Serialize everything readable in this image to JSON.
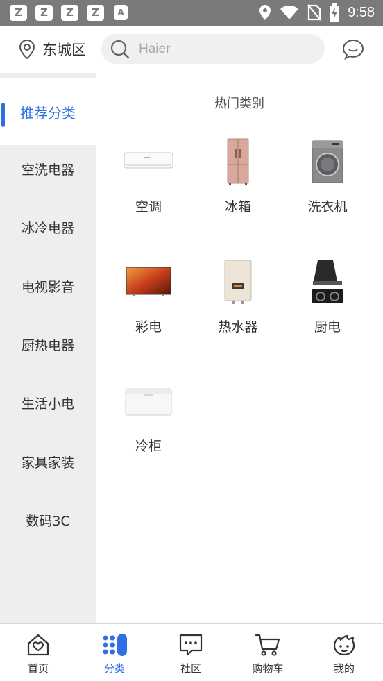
{
  "status_bar": {
    "app_icons": [
      "Z",
      "Z",
      "Z",
      "Z",
      "A"
    ],
    "time": "9:58",
    "icons": [
      "location-icon",
      "wifi-icon",
      "no-sim-icon",
      "battery-charging-icon"
    ]
  },
  "header": {
    "location": "东城区",
    "search_placeholder": "Haier",
    "icons": [
      "location-pin-icon",
      "search-icon",
      "message-icon"
    ]
  },
  "sidebar": {
    "items": [
      {
        "label": "推荐分类",
        "active": true
      },
      {
        "label": "空洗电器",
        "active": false
      },
      {
        "label": "冰冷电器",
        "active": false
      },
      {
        "label": "电视影音",
        "active": false
      },
      {
        "label": "厨热电器",
        "active": false
      },
      {
        "label": "生活小电",
        "active": false
      },
      {
        "label": "家具家装",
        "active": false
      },
      {
        "label": "数码3C",
        "active": false
      }
    ]
  },
  "main": {
    "section_title": "热门类别",
    "categories": [
      {
        "label": "空调",
        "icon": "air-conditioner-image"
      },
      {
        "label": "冰箱",
        "icon": "refrigerator-image"
      },
      {
        "label": "洗衣机",
        "icon": "washing-machine-image"
      },
      {
        "label": "彩电",
        "icon": "tv-image"
      },
      {
        "label": "热水器",
        "icon": "water-heater-image"
      },
      {
        "label": "厨电",
        "icon": "kitchen-appliance-image"
      },
      {
        "label": "冷柜",
        "icon": "freezer-image"
      }
    ]
  },
  "tabbar": {
    "tabs": [
      {
        "label": "首页",
        "icon": "home-icon",
        "active": false
      },
      {
        "label": "分类",
        "icon": "category-icon",
        "active": true
      },
      {
        "label": "社区",
        "icon": "community-icon",
        "active": false
      },
      {
        "label": "购物车",
        "icon": "cart-icon",
        "active": false
      },
      {
        "label": "我的",
        "icon": "profile-icon",
        "active": false
      }
    ]
  },
  "colors": {
    "accent": "#2f6fe4",
    "status_bar": "#7a7a7a",
    "sidebar_bg": "#eeeeee"
  }
}
